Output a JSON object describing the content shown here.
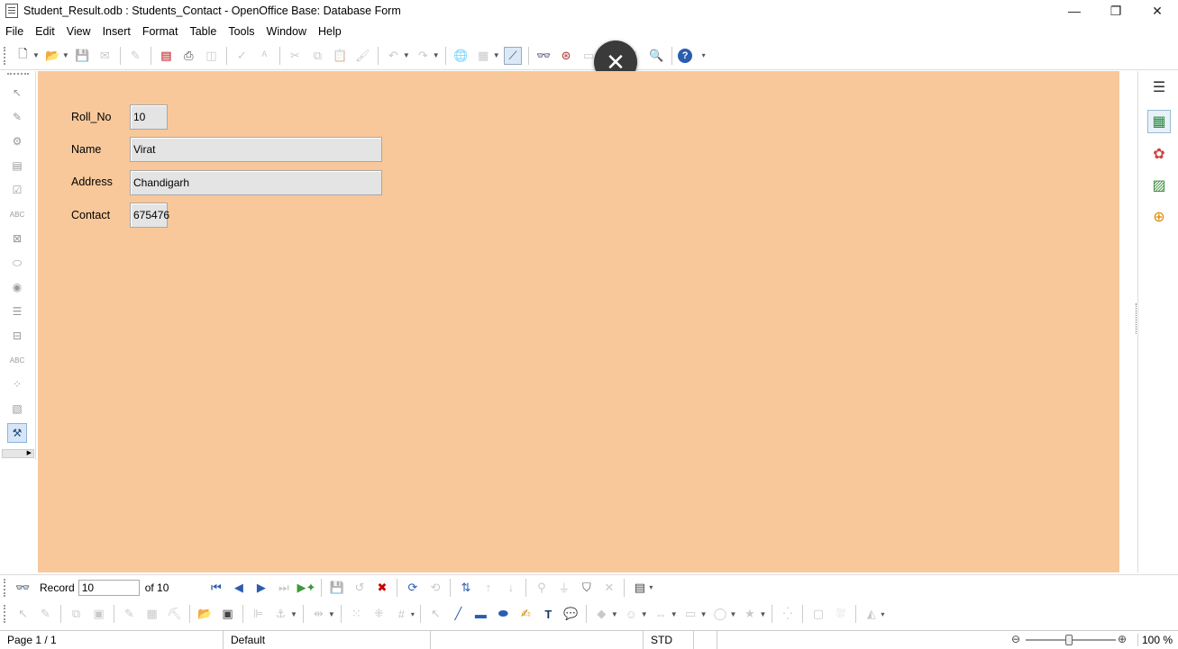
{
  "window": {
    "title": "Student_Result.odb : Students_Contact - OpenOffice Base: Database Form",
    "minimize": "—",
    "maximize": "❐",
    "close": "✕"
  },
  "menu": [
    "File",
    "Edit",
    "View",
    "Insert",
    "Format",
    "Table",
    "Tools",
    "Window",
    "Help"
  ],
  "overlay": {
    "close_glyph": "✕"
  },
  "form": {
    "fields": [
      {
        "label": "Roll_No",
        "value": "10"
      },
      {
        "label": "Name",
        "value": "Virat"
      },
      {
        "label": "Address",
        "value": "Chandigarh"
      },
      {
        "label": "Contact",
        "value": "675476"
      }
    ],
    "background_color": "#f8c89a"
  },
  "navigation": {
    "record_label": "Record",
    "record_value": "10",
    "of_label": "of 10"
  },
  "status": {
    "page": "Page 1 / 1",
    "style": "Default",
    "mode": "STD",
    "zoom": "100 %"
  }
}
